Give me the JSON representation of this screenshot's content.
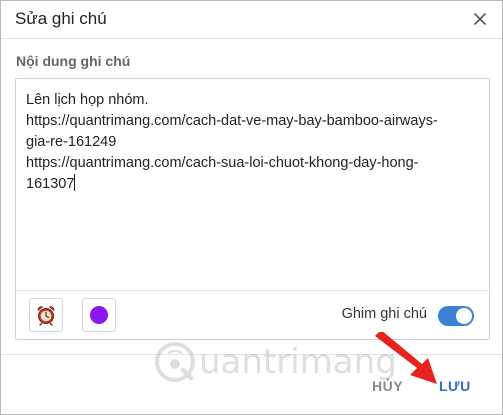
{
  "dialog": {
    "title": "Sửa ghi chú",
    "close_icon": "close-icon"
  },
  "note": {
    "section_label": "Nội dung ghi chú",
    "lines": [
      "Lên lịch họp nhóm.",
      "https://quantrimang.com/cach-dat-ve-may-bay-bamboo-airways-",
      "gia-re-161249",
      "https://quantrimang.com/cach-sua-loi-chuot-khong-day-hong-",
      "161307"
    ]
  },
  "footer": {
    "alarm_icon": "alarm-clock-icon",
    "color_value": "#8a16f2",
    "pin_label": "Ghim ghi chú",
    "pin_enabled": true,
    "toggle_color": "#3b82d6"
  },
  "actions": {
    "cancel_label": "HỦY",
    "save_label": "LƯU",
    "save_color": "#2a6fd1"
  },
  "watermark": {
    "text": "uantrimang",
    "logo_icon": "quantrimang-logo-icon"
  },
  "annotation": {
    "arrow_icon": "red-arrow-icon",
    "arrow_color": "#e8231f"
  }
}
